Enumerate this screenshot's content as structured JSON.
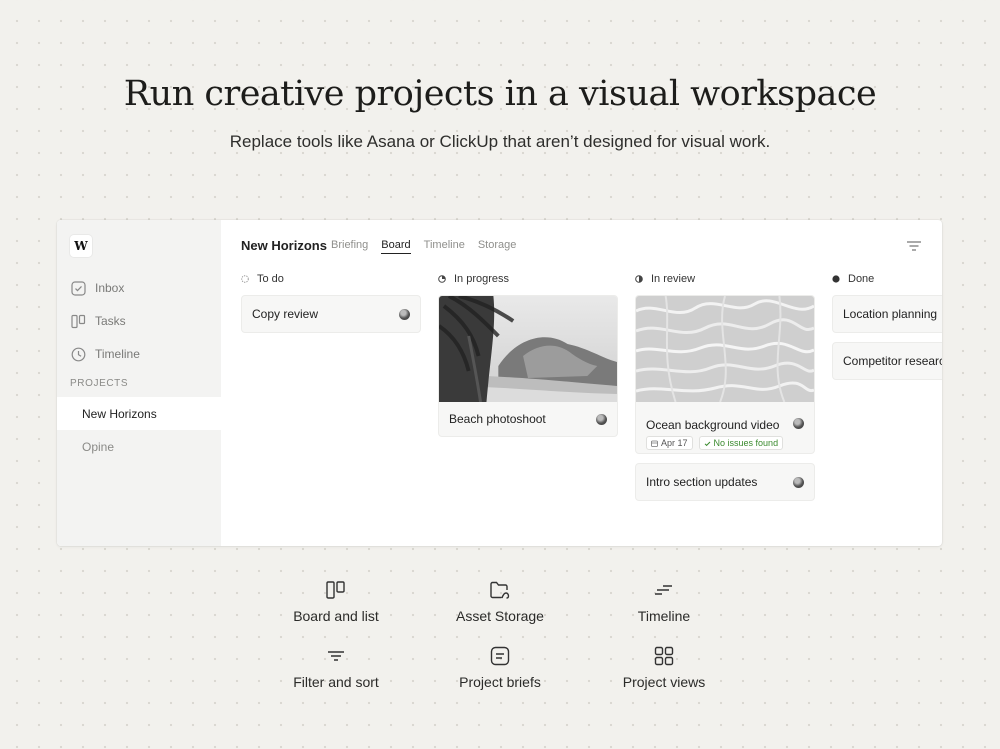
{
  "hero": {
    "title": "Run creative projects in a visual workspace",
    "subtitle": "Replace tools like Asana or ClickUp that aren’t designed for visual work."
  },
  "app": {
    "logo": "W",
    "nav": [
      {
        "label": "Inbox",
        "icon": "inbox-check-icon"
      },
      {
        "label": "Tasks",
        "icon": "board-icon"
      },
      {
        "label": "Timeline",
        "icon": "clock-icon"
      }
    ],
    "projects_label": "PROJECTS",
    "projects": [
      {
        "label": "New Horizons",
        "active": true
      },
      {
        "label": "Opine",
        "active": false
      }
    ],
    "project_title": "New Horizons",
    "tabs": [
      {
        "label": "Briefing",
        "active": false
      },
      {
        "label": "Board",
        "active": true
      },
      {
        "label": "Timeline",
        "active": false
      },
      {
        "label": "Storage",
        "active": false
      }
    ],
    "columns": [
      {
        "title": "To do",
        "status_icon": "dashed-circle-icon",
        "cards": [
          {
            "title": "Copy review"
          }
        ]
      },
      {
        "title": "In progress",
        "status_icon": "partial-circle-icon",
        "cards": [
          {
            "title": "Beach photoshoot",
            "image": "beach-photo"
          }
        ]
      },
      {
        "title": "In review",
        "status_icon": "half-circle-icon",
        "cards": [
          {
            "title": "Ocean background video",
            "image": "water-photo",
            "date": "Apr 17",
            "status": "No issues found"
          },
          {
            "title": "Intro section updates"
          }
        ]
      },
      {
        "title": "Done",
        "status_icon": "filled-circle-icon",
        "cards": [
          {
            "title": "Location planning"
          },
          {
            "title": "Competitor research"
          }
        ]
      }
    ]
  },
  "features": [
    {
      "label": "Board and list",
      "icon": "board-icon"
    },
    {
      "label": "Asset Storage",
      "icon": "folder-icon"
    },
    {
      "label": "Timeline",
      "icon": "timeline-icon"
    },
    {
      "label": "Filter and sort",
      "icon": "filter-icon"
    },
    {
      "label": "Project briefs",
      "icon": "brief-icon"
    },
    {
      "label": "Project views",
      "icon": "grid-icon"
    }
  ],
  "colors": {
    "background": "#f2f1ed",
    "sidebar": "#f3f3f2",
    "success": "#3a8a2e"
  }
}
